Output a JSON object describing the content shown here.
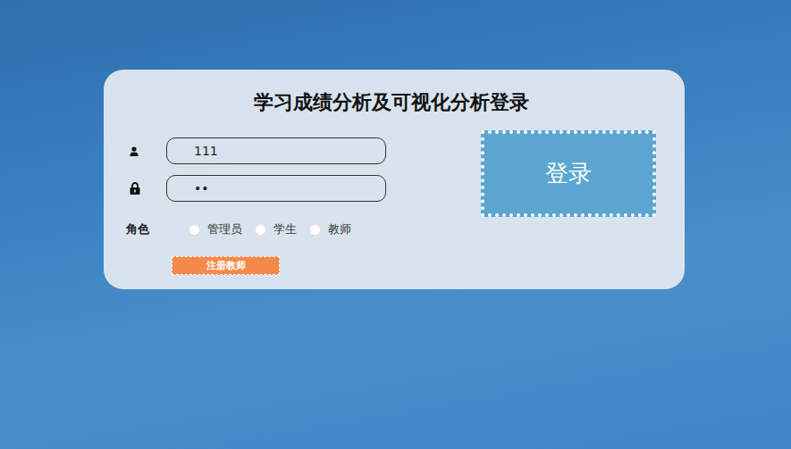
{
  "title": "学习成绩分析及可视化分析登录",
  "fields": [
    {
      "kind": "username",
      "value": "111"
    },
    {
      "kind": "password",
      "value": "••"
    }
  ],
  "role": {
    "label": "角色",
    "options": [
      {
        "label": "管理员",
        "selected": false
      },
      {
        "label": "学生",
        "selected": false
      },
      {
        "label": "教师",
        "selected": false
      }
    ]
  },
  "register_button": "注册教师",
  "login_button": "登录"
}
